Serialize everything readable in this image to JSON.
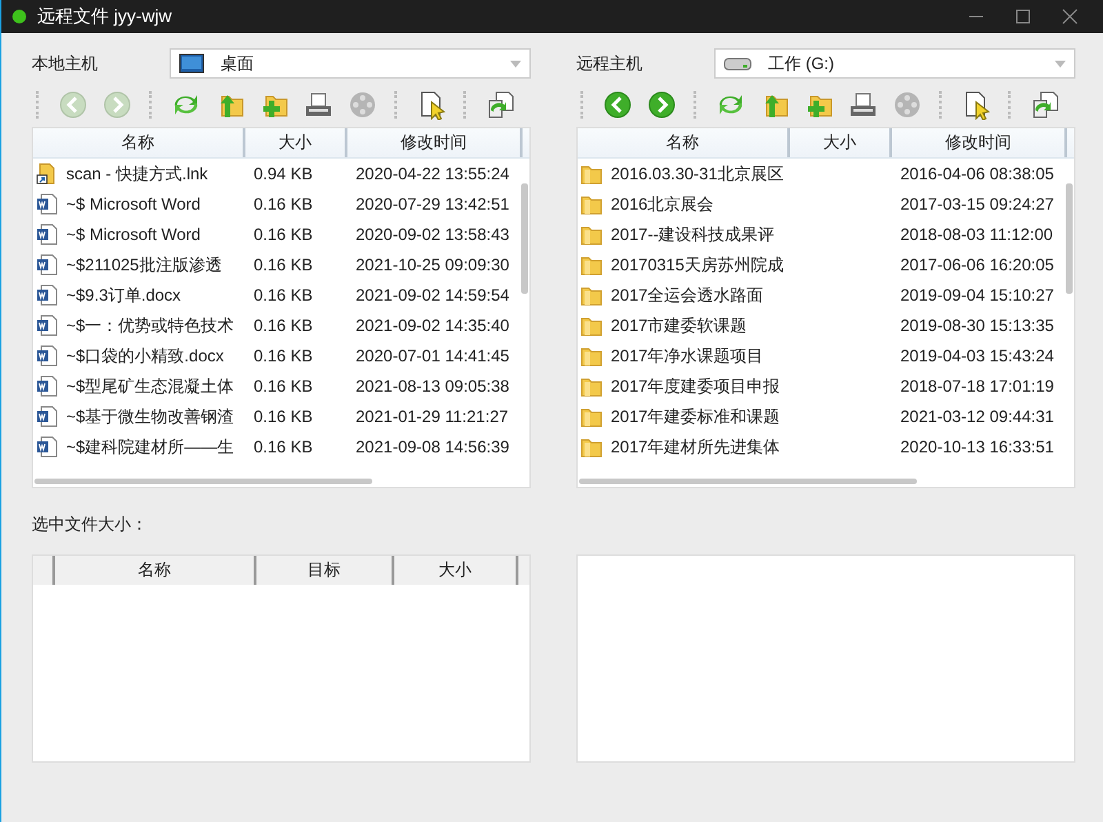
{
  "window": {
    "title": "远程文件 jyy-wjw"
  },
  "panels": [
    {
      "label": "本地主机",
      "location": {
        "kind": "desktop",
        "text": "桌面"
      },
      "toolbar": [
        {
          "kind": "back",
          "disabled": true
        },
        {
          "kind": "forward",
          "disabled": true
        },
        {
          "kind": "refresh",
          "disabled": false
        },
        {
          "kind": "up",
          "disabled": false
        },
        {
          "kind": "new-folder",
          "disabled": false
        },
        {
          "kind": "printer",
          "disabled": false
        },
        {
          "kind": "stop",
          "disabled": true
        },
        {
          "kind": "select",
          "disabled": false
        },
        {
          "kind": "transfer",
          "disabled": false
        }
      ],
      "columns": [
        "名称",
        "大小",
        "修改时间"
      ],
      "rows": [
        {
          "kind": "shortcut",
          "name": "scan - 快捷方式.lnk",
          "size": "0.94 KB",
          "modified": "2020-04-22 13:55:24"
        },
        {
          "kind": "word",
          "name": "~$ Microsoft Word",
          "size": "0.16 KB",
          "modified": "2020-07-29 13:42:51"
        },
        {
          "kind": "word",
          "name": "~$ Microsoft Word",
          "size": "0.16 KB",
          "modified": "2020-09-02 13:58:43"
        },
        {
          "kind": "word",
          "name": "~$211025批注版渗透",
          "size": "0.16 KB",
          "modified": "2021-10-25 09:09:30"
        },
        {
          "kind": "word",
          "name": "~$9.3订单.docx",
          "size": "0.16 KB",
          "modified": "2021-09-02 14:59:54"
        },
        {
          "kind": "word",
          "name": "~$一：优势或特色技术",
          "size": "0.16 KB",
          "modified": "2021-09-02 14:35:40"
        },
        {
          "kind": "word",
          "name": "~$口袋的小精致.docx",
          "size": "0.16 KB",
          "modified": "2020-07-01 14:41:45"
        },
        {
          "kind": "word",
          "name": "~$型尾矿生态混凝土体",
          "size": "0.16 KB",
          "modified": "2021-08-13 09:05:38"
        },
        {
          "kind": "word",
          "name": "~$基于微生物改善钢渣",
          "size": "0.16 KB",
          "modified": "2021-01-29 11:21:27"
        },
        {
          "kind": "word",
          "name": "~$建科院建材所——生",
          "size": "0.16 KB",
          "modified": "2021-09-08 14:56:39"
        }
      ]
    },
    {
      "label": "远程主机",
      "location": {
        "kind": "drive",
        "text": "工作 (G:)"
      },
      "toolbar": [
        {
          "kind": "back",
          "disabled": false
        },
        {
          "kind": "forward",
          "disabled": false
        },
        {
          "kind": "refresh",
          "disabled": false
        },
        {
          "kind": "up",
          "disabled": false
        },
        {
          "kind": "new-folder",
          "disabled": false
        },
        {
          "kind": "printer",
          "disabled": false
        },
        {
          "kind": "stop",
          "disabled": true
        },
        {
          "kind": "select",
          "disabled": false
        },
        {
          "kind": "transfer",
          "disabled": false
        }
      ],
      "columns": [
        "名称",
        "大小",
        "修改时间"
      ],
      "rows": [
        {
          "kind": "folder",
          "name": "2016.03.30-31北京展区",
          "size": "",
          "modified": "2016-04-06 08:38:05"
        },
        {
          "kind": "folder",
          "name": "2016北京展会",
          "size": "",
          "modified": "2017-03-15 09:24:27"
        },
        {
          "kind": "folder",
          "name": "2017--建设科技成果评",
          "size": "",
          "modified": "2018-08-03 11:12:00"
        },
        {
          "kind": "folder",
          "name": "20170315天房苏州院成",
          "size": "",
          "modified": "2017-06-06 16:20:05"
        },
        {
          "kind": "folder",
          "name": "2017全运会透水路面",
          "size": "",
          "modified": "2019-09-04 15:10:27"
        },
        {
          "kind": "folder",
          "name": "2017市建委软课题",
          "size": "",
          "modified": "2019-08-30 15:13:35"
        },
        {
          "kind": "folder",
          "name": "2017年净水课题项目",
          "size": "",
          "modified": "2019-04-03 15:43:24"
        },
        {
          "kind": "folder",
          "name": "2017年度建委项目申报",
          "size": "",
          "modified": "2018-07-18 17:01:19"
        },
        {
          "kind": "folder",
          "name": "2017年建委标准和课题",
          "size": "",
          "modified": "2021-03-12 09:44:31"
        },
        {
          "kind": "folder",
          "name": "2017年建材所先进集体",
          "size": "",
          "modified": "2020-10-13 16:33:51"
        }
      ]
    }
  ],
  "selection": {
    "label": "选中文件大小：",
    "columns": [
      "名称",
      "目标",
      "大小"
    ]
  }
}
